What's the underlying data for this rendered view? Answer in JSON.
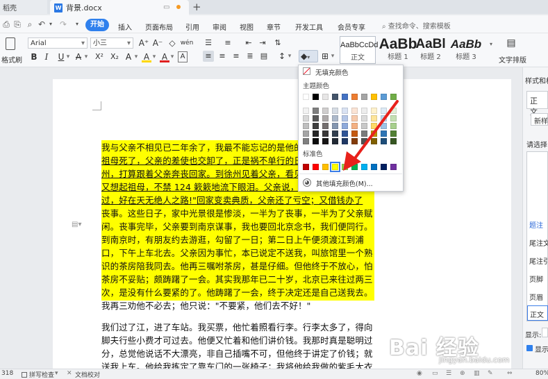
{
  "tabs": {
    "left_tab": "稻壳",
    "doc_tab": "背景.docx",
    "new_tab_symbol": "+"
  },
  "menu": {
    "items": [
      "开始",
      "插入",
      "页面布局",
      "引用",
      "审阅",
      "视图",
      "章节",
      "开发工具",
      "会员专享"
    ],
    "search_placeholder": "查找命令、搜索模板",
    "undo_symbol": "↶",
    "redo_symbol": "↷"
  },
  "toolbar": {
    "format_brush_label": "格式刷",
    "font_name": "Arial",
    "font_size": "小三",
    "font_grow": "A⁺",
    "font_shrink": "A⁻",
    "clear_format": "◇",
    "pinyin": "wén",
    "bold": "B",
    "italic": "I",
    "underline": "U",
    "strikethrough": "A",
    "superscript": "X²",
    "subscript": "X₂",
    "font_color": "A",
    "char_border": "A",
    "highlight": "A",
    "text_effect": "A",
    "line_spacing": "↕",
    "fill_icon": "◆",
    "border_icon": "⊞",
    "style_gallery": [
      {
        "sample": "AaBbCcDd",
        "caption": "正文"
      },
      {
        "sample": "AaBb",
        "caption": "标题 1"
      },
      {
        "sample": "AaBl",
        "caption": "标题 2"
      },
      {
        "sample": "AaBb",
        "caption": "标题 3"
      }
    ],
    "text_layout_label": "文字排版"
  },
  "fill_dropdown": {
    "no_fill": "无填充颜色",
    "theme_colors_label": "主题颜色",
    "standard_colors_label": "标准色",
    "more_colors": "其他填充颜色(M)...",
    "theme_top_row": [
      "#ffffff",
      "#000000",
      "#e7e6e6",
      "#44546a",
      "#4472c4",
      "#ed7d31",
      "#a5a5a5",
      "#ffc000",
      "#5b9bd5",
      "#70ad47"
    ],
    "theme_shades": [
      [
        "#f2f2f2",
        "#7f7f7f",
        "#d0cece",
        "#d6dce4",
        "#d9e2f3",
        "#fbe4d5",
        "#ededed",
        "#fff2cc",
        "#deebf6",
        "#e2efd9"
      ],
      [
        "#d8d8d8",
        "#595959",
        "#aeaaaa",
        "#adb9ca",
        "#b4c6e7",
        "#f7caac",
        "#dbdbdb",
        "#fee599",
        "#bdd7ee",
        "#c5e0b3"
      ],
      [
        "#bfbfbf",
        "#3f3f3f",
        "#757070",
        "#8496b0",
        "#8eaadb",
        "#f4b183",
        "#c9c9c9",
        "#ffd965",
        "#9cc3e5",
        "#a8d08d"
      ],
      [
        "#a5a5a5",
        "#262626",
        "#3a3838",
        "#323f4f",
        "#2f5496",
        "#c55a11",
        "#7b7b7b",
        "#bf8f00",
        "#2e75b5",
        "#538135"
      ],
      [
        "#7f7f7f",
        "#0c0c0c",
        "#171616",
        "#222a35",
        "#1f3864",
        "#833c0b",
        "#525252",
        "#7f5f00",
        "#1e4e79",
        "#375623"
      ]
    ],
    "standard_colors": [
      "#c00000",
      "#ff0000",
      "#ffc000",
      "#ffff00",
      "#92d050",
      "#00b050",
      "#00b0f0",
      "#0070c0",
      "#002060",
      "#7030a0"
    ],
    "selected_color": "#ffff00"
  },
  "document": {
    "highlight_color": "#ffff00",
    "para1": [
      {
        "text": "我与父亲不相见已二年余了，我最不能忘记的是他的",
        "u": false
      },
      {
        "text": "祖母死了，父亲的差使也交卸了，正是祸不单行的日",
        "u": true
      },
      {
        "text": "州，打算跟着父亲奔丧回家。到徐州见着父亲，看见",
        "u": true
      },
      {
        "text": "又想起祖母，不禁 124 簌簌地流下眼泪。父亲说，",
        "u": true
      },
      {
        "text": "过，好在天无绝人之路!\"回家变卖典质，父亲还了亏空；又借钱办了",
        "u": true
      },
      {
        "text": "丧事。这些日子，家中光景很是惨淡，一半为了丧事，一半为了父亲赋",
        "u": false
      },
      {
        "text": "闲。丧事完毕，父亲要到南京谋事，我也要回北京念书，我们便同行。",
        "u": false
      },
      {
        "text": "到南京时，有朋友约去游逛，勾留了一日；第二日上午便须渡江到浦",
        "u": false
      },
      {
        "text": "口，下午上车北去。父亲因为事忙，本已说定不送我，叫旅馆里一个熟",
        "u": false
      },
      {
        "text": "识的茶房陪我同去。他再三嘱咐茶房，甚是仔细。但他终于不放心，怕",
        "u": false
      },
      {
        "text": "茶房不妥贴；颇踌躇了一会。其实我那年已二十岁，北京已来往过两三",
        "u": false
      },
      {
        "text": "次，是没有什么要紧的了。他踌躇了一会，终于决定还是自己送我去。",
        "u": false
      },
      {
        "text": "我再三劝他不必去；他只说：\"不要紧，他们去不好！\"",
        "u": false
      }
    ],
    "para2": [
      "我们过了江，进了车站。我买票，他忙着照看行李。行李太多了，得向",
      "脚夫行些小费才可过去。他便又忙着和他们讲价钱。我那时真是聪明过",
      "分，总觉他说话不大漂亮，非自己插嘴不可，但他终于讲定了价钱；就",
      "送我上车。他给我拣定了靠车门的一张椅子；我将他给我做的紫毛大衣"
    ]
  },
  "right_panel": {
    "title": "样式和格",
    "current_style": "正文",
    "new_style": "新样",
    "choose_label": "请选择",
    "items": [
      "题注",
      "尾注文",
      "尾注引",
      "页脚",
      "页眉",
      "正文"
    ],
    "show_label": "显示:",
    "show_checkbox_label": "显示"
  },
  "status": {
    "page_count": "318",
    "spell_check": "拼写检查",
    "doc_check": "文档校对",
    "zoom": "80%"
  },
  "watermark": {
    "main": "Bai 经验",
    "sub": "jingyan.baidu.com"
  }
}
